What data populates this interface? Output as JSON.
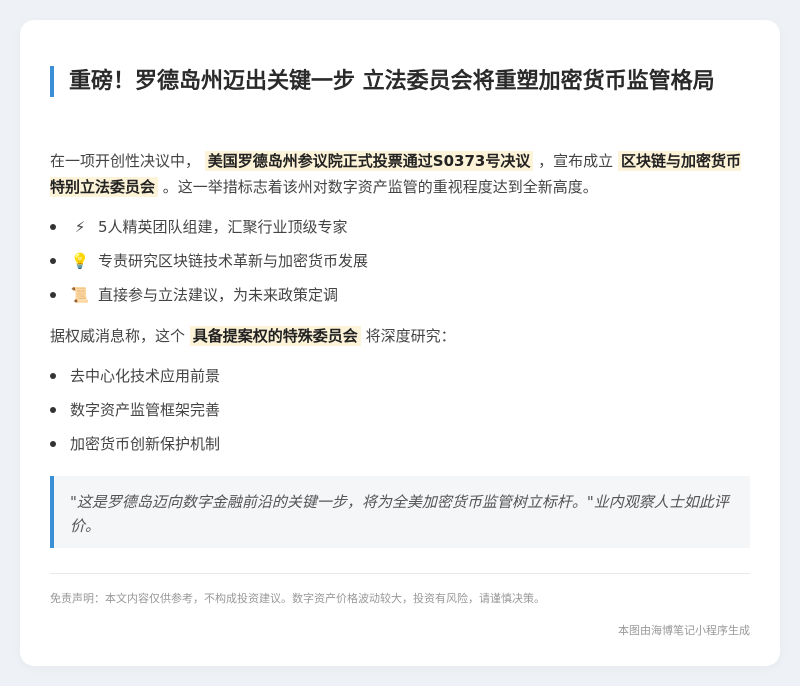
{
  "article": {
    "title": "重磅！罗德岛州迈出关键一步 立法委员会将重塑加密货币监管格局",
    "intro": {
      "prefix": "在一项开创性决议中，",
      "highlight1": "美国罗德岛州参议院正式投票通过S0373号决议",
      "middle": "，宣布成立",
      "highlight2": "区块链与加密货币特别立法委员会",
      "suffix": "。这一举措标志着该州对数字资产监管的重视程度达到全新高度。"
    },
    "features": [
      {
        "icon": "⚡",
        "icon_name": "lightning-icon",
        "text": "5人精英团队组建，汇聚行业顶级专家"
      },
      {
        "icon": "💡",
        "icon_name": "lightbulb-icon",
        "text": "专责研究区块链技术革新与加密货币发展"
      },
      {
        "icon": "📜",
        "icon_name": "scroll-icon",
        "text": "直接参与立法建议，为未来政策定调"
      }
    ],
    "authority": {
      "prefix": "据权威消息称，这个",
      "highlight": "具备提案权的特殊委员会",
      "suffix": "将深度研究："
    },
    "research_items": [
      "去中心化技术应用前景",
      "数字资产监管框架完善",
      "加密货币创新保护机制"
    ],
    "quote": "\"这是罗德岛迈向数字金融前沿的关键一步，将为全美加密货币监管树立标杆。\"业内观察人士如此评价。",
    "disclaimer": "免责声明：本文内容仅供参考，不构成投资建议。数字资产价格波动较大，投资有风险，请谨慎决策。",
    "footer": "本图由海博笔记小程序生成"
  },
  "colors": {
    "accent": "#3b8fd6",
    "highlight_bg": "#fdf3d8",
    "page_bg": "#eef1f5"
  }
}
